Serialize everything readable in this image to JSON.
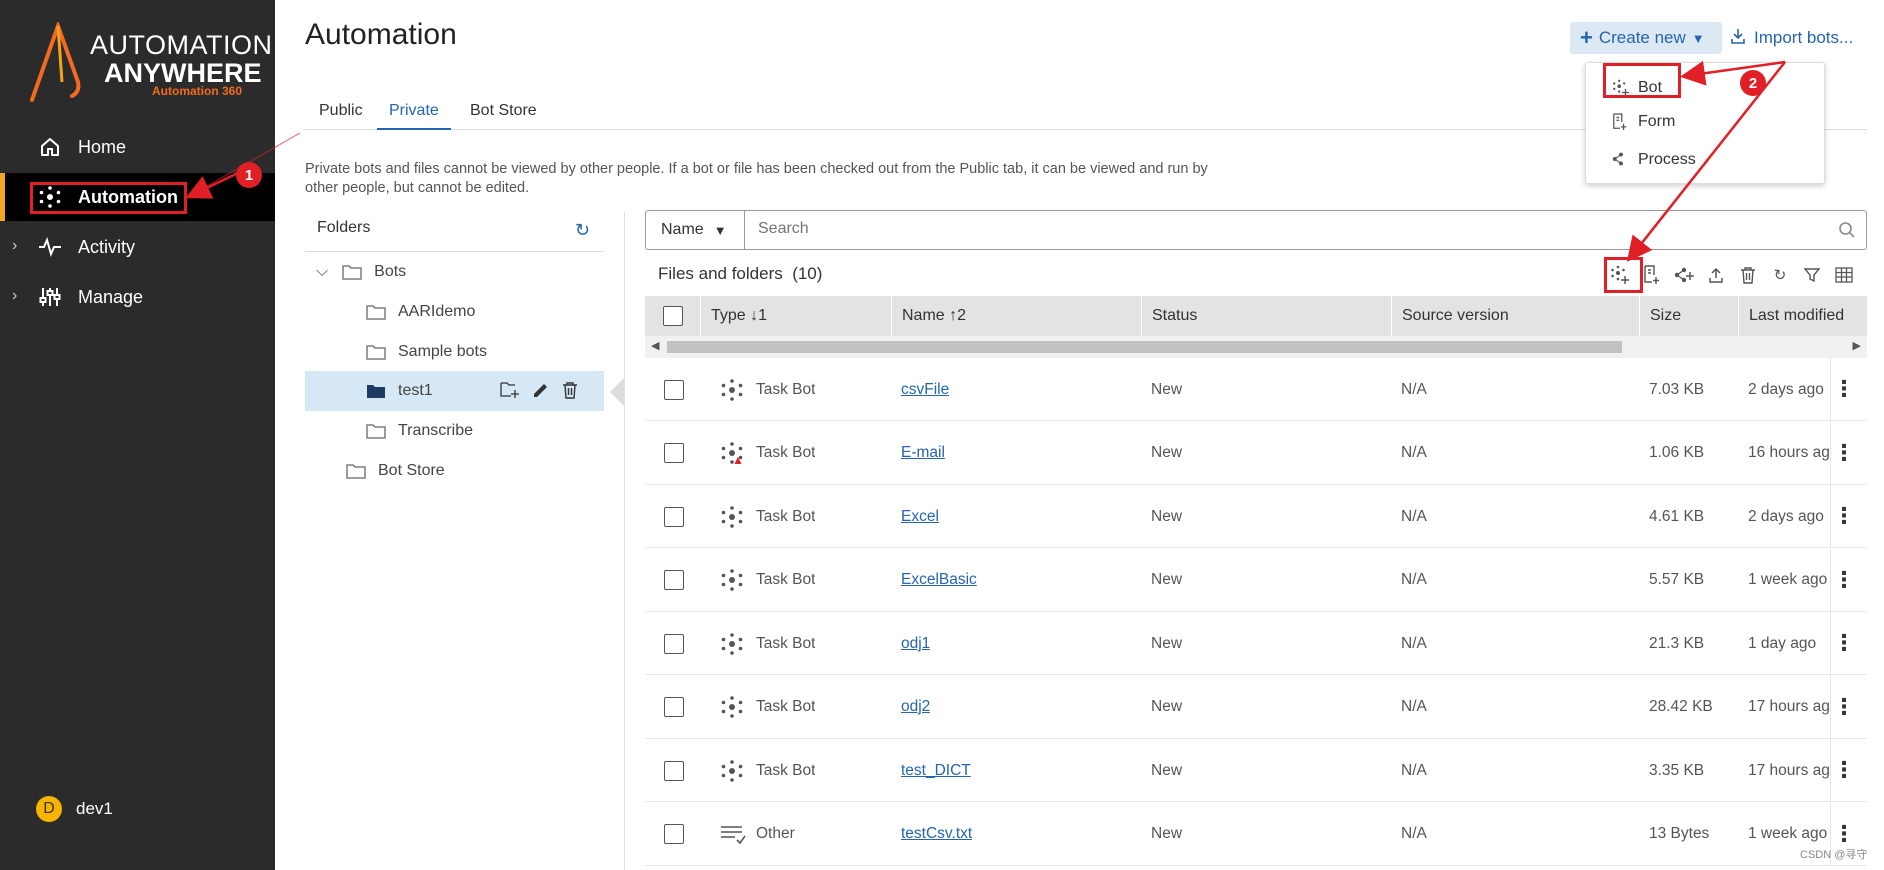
{
  "brand": {
    "line1": "AUTOMATION",
    "line2": "ANYWHERE",
    "line3": "Automation 360"
  },
  "sidebar": {
    "items": [
      {
        "label": "Home",
        "icon": "home-icon"
      },
      {
        "label": "Automation",
        "icon": "bot-icon"
      },
      {
        "label": "Activity",
        "icon": "activity-icon"
      },
      {
        "label": "Manage",
        "icon": "manage-icon"
      }
    ],
    "user": {
      "initial": "D",
      "name": "dev1"
    }
  },
  "page": {
    "title": "Automation",
    "tabs": [
      "Public",
      "Private",
      "Bot Store"
    ],
    "active_tab": "Private",
    "description_line1": "Private bots and files cannot be viewed by other people. If a bot or file has been checked out from the Public tab, it can be viewed and run by",
    "description_line2": "other people, but cannot be edited."
  },
  "actions": {
    "create_new": "Create new",
    "import_bots": "Import bots..."
  },
  "create_menu": {
    "items": [
      "Bot",
      "Form",
      "Process"
    ]
  },
  "folders": {
    "title": "Folders",
    "tree": [
      {
        "label": "Bots"
      },
      {
        "label": "AARIdemo"
      },
      {
        "label": "Sample bots"
      },
      {
        "label": "test1"
      },
      {
        "label": "Transcribe"
      },
      {
        "label": "Bot Store"
      }
    ]
  },
  "search": {
    "field": "Name",
    "placeholder": "Search"
  },
  "files": {
    "title": "Files and folders",
    "count": "(10)",
    "columns": [
      "Type ↓1",
      "Name ↑2",
      "Status",
      "Source version",
      "Size",
      "Last modified"
    ],
    "rows": [
      {
        "type": "Task Bot",
        "name": "csvFile",
        "status": "New",
        "source": "N/A",
        "size": "7.03 KB",
        "modified": "2 days ago",
        "warning": false
      },
      {
        "type": "Task Bot",
        "name": "E-mail",
        "status": "New",
        "source": "N/A",
        "size": "1.06 KB",
        "modified": "16 hours ag",
        "warning": true
      },
      {
        "type": "Task Bot",
        "name": "Excel",
        "status": "New",
        "source": "N/A",
        "size": "4.61 KB",
        "modified": "2 days ago",
        "warning": false
      },
      {
        "type": "Task Bot",
        "name": "ExcelBasic",
        "status": "New",
        "source": "N/A",
        "size": "5.57 KB",
        "modified": "1 week ago",
        "warning": false
      },
      {
        "type": "Task Bot",
        "name": "odj1",
        "status": "New",
        "source": "N/A",
        "size": "21.3 KB",
        "modified": "1 day ago",
        "warning": false
      },
      {
        "type": "Task Bot",
        "name": "odj2",
        "status": "New",
        "source": "N/A",
        "size": "28.42 KB",
        "modified": "17 hours ag",
        "warning": false
      },
      {
        "type": "Task Bot",
        "name": "test_DICT",
        "status": "New",
        "source": "N/A",
        "size": "3.35 KB",
        "modified": "17 hours ag",
        "warning": false
      },
      {
        "type": "Other",
        "name": "testCsv.txt",
        "status": "New",
        "source": "N/A",
        "size": "13 Bytes",
        "modified": "1 week ago",
        "warning": false
      }
    ]
  },
  "annotations": {
    "step1": "1",
    "step2": "2"
  },
  "watermark": "CSDN @寻守",
  "colors": {
    "accent": "#2565ae",
    "brand_orange": "#f26b21",
    "annotation_red": "#e01f26",
    "sidebar_bg": "#2b2b2b"
  }
}
